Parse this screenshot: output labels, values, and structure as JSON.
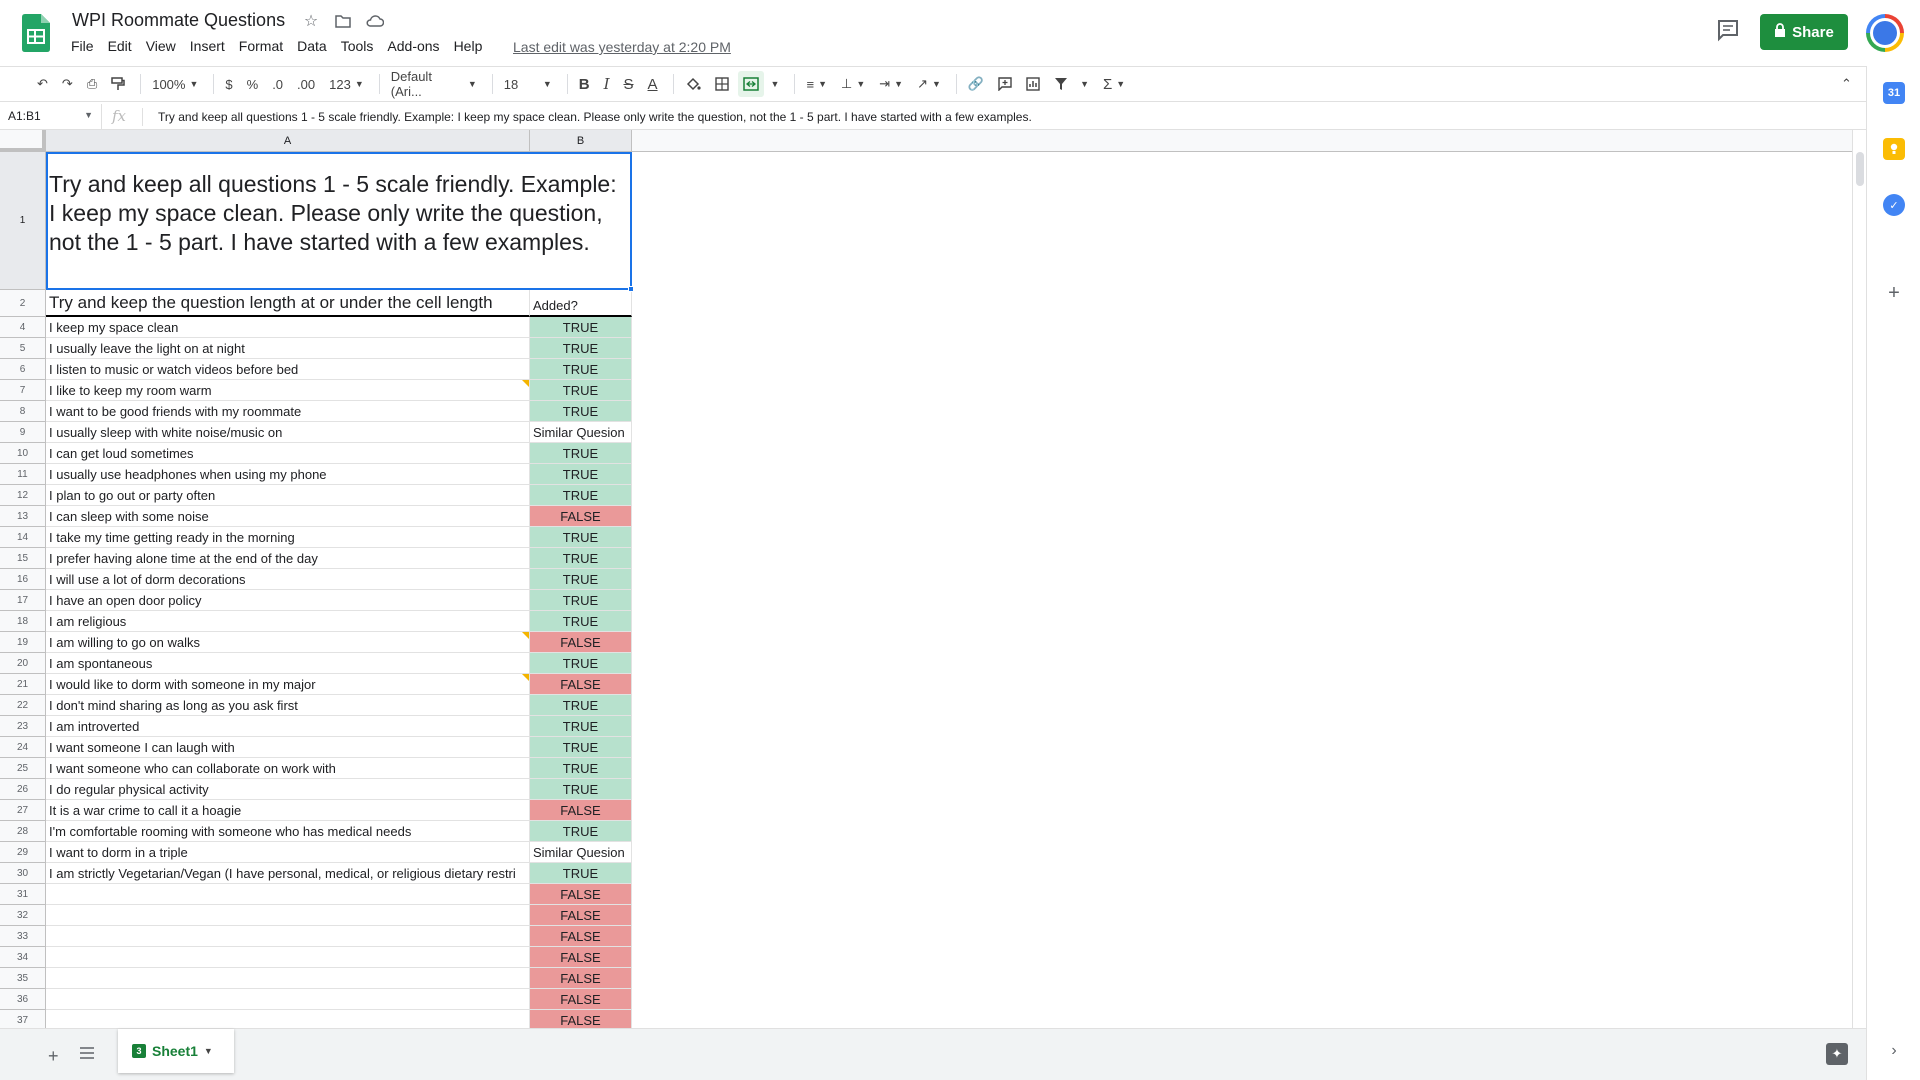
{
  "app": {
    "doc_title": "WPI Roommate Questions",
    "last_edit": "Last edit was yesterday at 2:20 PM",
    "share_label": "Share"
  },
  "menu": [
    "File",
    "Edit",
    "View",
    "Insert",
    "Format",
    "Data",
    "Tools",
    "Add-ons",
    "Help"
  ],
  "toolbar": {
    "zoom": "100%",
    "currency": "$",
    "percent": "%",
    "dec_decrease": ".0",
    "dec_increase": ".00",
    "more_formats": "123",
    "font": "Default (Ari...",
    "font_size": "18"
  },
  "formula_bar": {
    "name_box": "A1:B1",
    "fx": "fx",
    "content": "Try and keep all questions 1 - 5 scale friendly. Example: I keep my space clean. Please only write the question, not the 1 - 5 part. I have started with a few examples."
  },
  "grid": {
    "columns": [
      "A",
      "B"
    ],
    "row1": {
      "num": "1",
      "a": "Try and keep all questions 1 - 5 scale friendly. Example: I keep my space clean. Please only write the question, not the 1 - 5 part. I have started with a few examples."
    },
    "row2": {
      "num": "2",
      "a": "Try and keep the question length at or under the cell length",
      "b": "Added?"
    },
    "rows": [
      {
        "num": "4",
        "a": "I keep my space clean",
        "b": "TRUE"
      },
      {
        "num": "5",
        "a": "I usually leave the light on at night",
        "b": "TRUE"
      },
      {
        "num": "6",
        "a": "I listen to music or watch videos before bed",
        "b": "TRUE"
      },
      {
        "num": "7",
        "a": "I like to keep my room warm",
        "b": "TRUE"
      },
      {
        "num": "8",
        "a": "I want to be good friends with my roommate",
        "b": "TRUE"
      },
      {
        "num": "9",
        "a": "I usually sleep with white noise/music on",
        "b": "Similar Quesion"
      },
      {
        "num": "10",
        "a": "I can get loud sometimes",
        "b": "TRUE"
      },
      {
        "num": "11",
        "a": "I usually use headphones when using my phone",
        "b": "TRUE"
      },
      {
        "num": "12",
        "a": "I plan to go out or party often",
        "b": "TRUE"
      },
      {
        "num": "13",
        "a": "I can sleep with some noise",
        "b": "FALSE"
      },
      {
        "num": "14",
        "a": "I take my time getting ready in the morning",
        "b": "TRUE"
      },
      {
        "num": "15",
        "a": "I prefer having alone time at the end of the day",
        "b": "TRUE"
      },
      {
        "num": "16",
        "a": "I will use a lot of dorm decorations",
        "b": "TRUE"
      },
      {
        "num": "17",
        "a": "I have an open door policy",
        "b": "TRUE"
      },
      {
        "num": "18",
        "a": "I am religious",
        "b": "TRUE"
      },
      {
        "num": "19",
        "a": "I am willing to go on walks",
        "b": "FALSE"
      },
      {
        "num": "20",
        "a": "I am spontaneous",
        "b": "TRUE"
      },
      {
        "num": "21",
        "a": "I would like to dorm with someone in my major",
        "b": "FALSE"
      },
      {
        "num": "22",
        "a": "I don't mind sharing as long as you ask first",
        "b": "TRUE"
      },
      {
        "num": "23",
        "a": "I am introverted",
        "b": "TRUE"
      },
      {
        "num": "24",
        "a": "I want someone I can laugh with",
        "b": "TRUE"
      },
      {
        "num": "25",
        "a": "I want someone who can collaborate on work with",
        "b": "TRUE"
      },
      {
        "num": "26",
        "a": "I do regular physical activity",
        "b": "TRUE"
      },
      {
        "num": "27",
        "a": "It is a war crime to call it a hoagie",
        "b": "FALSE"
      },
      {
        "num": "28",
        "a": "I'm comfortable rooming with someone who has medical needs",
        "b": "TRUE"
      },
      {
        "num": "29",
        "a": "I want to dorm in a triple",
        "b": "Similar Quesion"
      },
      {
        "num": "30",
        "a": "I am strictly Vegetarian/Vegan (I have personal, medical, or religious dietary restri",
        "b": "TRUE"
      },
      {
        "num": "31",
        "a": "",
        "b": "FALSE"
      },
      {
        "num": "32",
        "a": "",
        "b": "FALSE"
      },
      {
        "num": "33",
        "a": "",
        "b": "FALSE"
      },
      {
        "num": "34",
        "a": "",
        "b": "FALSE"
      },
      {
        "num": "35",
        "a": "",
        "b": "FALSE"
      },
      {
        "num": "36",
        "a": "",
        "b": "FALSE"
      },
      {
        "num": "37",
        "a": "",
        "b": "FALSE"
      }
    ]
  },
  "sheets": [
    {
      "badge": "3",
      "name": "Sheet1"
    }
  ],
  "colors": {
    "true_fill": "#b7e1cd",
    "false_fill": "#ea9999",
    "accent": "#188038",
    "selection": "#1a73e8"
  }
}
